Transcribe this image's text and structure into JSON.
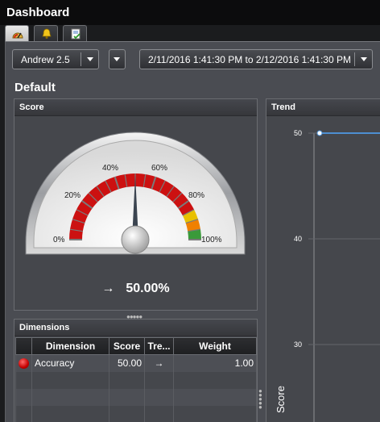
{
  "app": {
    "title": "Dashboard"
  },
  "tabs": [
    {
      "icon": "gauge-icon",
      "active": true
    },
    {
      "icon": "bell-icon",
      "active": false
    },
    {
      "icon": "checklist-icon",
      "active": false
    }
  ],
  "toolbar": {
    "scorecard": "Andrew 2.5",
    "date_range": "2/11/2016 1:41:30 PM to 2/12/2016 1:41:30 PM"
  },
  "section": {
    "title": "Default"
  },
  "score_panel": {
    "title": "Score",
    "tick_labels": [
      "0%",
      "20%",
      "40%",
      "60%",
      "80%",
      "100%"
    ],
    "value": 50,
    "readout_arrow": "→",
    "readout": "50.00%",
    "colors": {
      "red": "#cc1111",
      "yellow": "#e8c000",
      "orange": "#f08000",
      "green": "#3a9a3a"
    }
  },
  "dimensions_panel": {
    "title": "Dimensions",
    "columns": [
      "Dimension",
      "Score",
      "Tre...",
      "Weight"
    ],
    "rows": [
      {
        "status": "red",
        "dimension": "Accuracy",
        "score": "50.00",
        "trend": "→",
        "weight": "1.00"
      }
    ]
  },
  "trend_panel": {
    "title": "Trend",
    "ylabel": "Score"
  },
  "chart_data": {
    "type": "line",
    "title": "Trend",
    "ylabel": "Score",
    "y_ticks": [
      "50",
      "40",
      "30"
    ],
    "series": [
      {
        "values": [
          50,
          50
        ]
      }
    ],
    "color": "#4d8fd1"
  }
}
